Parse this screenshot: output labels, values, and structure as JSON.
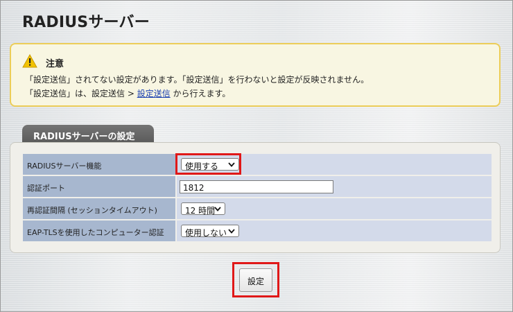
{
  "page": {
    "title": "RADIUSサーバー"
  },
  "notice": {
    "icon": "warning-icon",
    "title": "注意",
    "line1": "「設定送信」されてない設定があります。「設定送信」を行わないと設定が反映されません。",
    "line2_before": "「設定送信」は、設定送信 > ",
    "line2_link": "設定送信",
    "line2_after": " から行えます。",
    "colors": {
      "background": "#f8f6e2",
      "border": "#eccd58"
    }
  },
  "section": {
    "tab_label": "RADIUSサーバーの設定",
    "rows": [
      {
        "label": "RADIUSサーバー機能",
        "type": "select",
        "value": "使用する"
      },
      {
        "label": "認証ポート",
        "type": "text",
        "value": "1812"
      },
      {
        "label": "再認証間隔 (セッションタイムアウト)",
        "type": "select",
        "value": "12 時間"
      },
      {
        "label": "EAP-TLSを使用したコンピューター認証",
        "type": "select",
        "value": "使用しない"
      }
    ]
  },
  "submit": {
    "label": "設定"
  },
  "colors": {
    "highlight": "#e01818",
    "label_cell": "#a7b7cf",
    "value_cell": "#d3daea"
  }
}
